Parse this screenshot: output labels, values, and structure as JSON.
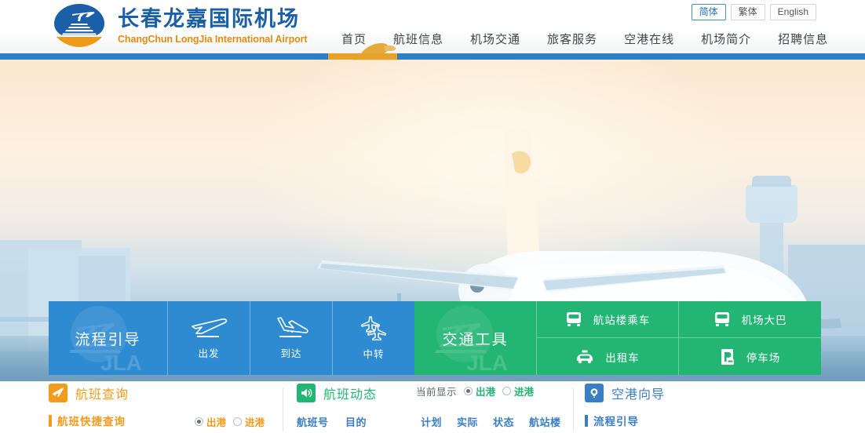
{
  "header": {
    "logo": {
      "name_cn": "长春龙嘉国际机场",
      "name_en": "ChangChun LongJia International Airport",
      "icon": "airport-roundel-logo"
    },
    "languages": [
      {
        "label": "简体",
        "active": true
      },
      {
        "label": "繁体",
        "active": false
      },
      {
        "label": "English",
        "active": false
      }
    ],
    "nav": [
      {
        "label": "首页",
        "active": true
      },
      {
        "label": "航班信息",
        "active": false
      },
      {
        "label": "机场交通",
        "active": false
      },
      {
        "label": "旅客服务",
        "active": false
      },
      {
        "label": "空港在线",
        "active": false
      },
      {
        "label": "机场简介",
        "active": false
      },
      {
        "label": "招聘信息",
        "active": false
      }
    ]
  },
  "hero": {
    "alt": "airliner-on-runway-at-sunset"
  },
  "service_panel": {
    "process_guide": {
      "title": "流程引导",
      "tiles": [
        {
          "label": "出发",
          "icon": "departure-plane-icon"
        },
        {
          "label": "到达",
          "icon": "arrival-plane-icon"
        },
        {
          "label": "中转",
          "icon": "transfer-plane-icon"
        }
      ]
    },
    "transport": {
      "title": "交通工具",
      "cells": [
        {
          "label": "航站楼乘车",
          "icon": "bus-icon"
        },
        {
          "label": "机场大巴",
          "icon": "bus-icon"
        },
        {
          "label": "出租车",
          "icon": "taxi-icon"
        },
        {
          "label": "停车场",
          "icon": "parking-icon"
        }
      ]
    },
    "colors": {
      "blue": "#2e8ad1",
      "green": "#23b573"
    }
  },
  "bottom": {
    "flight_query": {
      "title": "航班查询",
      "icon": "plane-icon",
      "sub_title": "航班快捷查询",
      "radios": [
        {
          "label": "出港",
          "selected": true
        },
        {
          "label": "进港",
          "selected": false
        }
      ]
    },
    "flight_status": {
      "title": "航班动态",
      "icon": "speaker-icon",
      "control_label": "当前显示",
      "radios": [
        {
          "label": "出港",
          "selected": true
        },
        {
          "label": "进港",
          "selected": false
        }
      ],
      "columns": [
        "航班号",
        "目的",
        "计划",
        "实际",
        "状态",
        "航站楼"
      ]
    },
    "airport_guide": {
      "title": "空港向导",
      "icon": "lightbulb-pin-icon",
      "sub_title": "流程引导"
    }
  },
  "colors": {
    "brand_blue": "#1a5fa8",
    "brand_orange": "#e08c15",
    "bar_blue": "#2f80c2",
    "accent_green": "#22b573"
  }
}
